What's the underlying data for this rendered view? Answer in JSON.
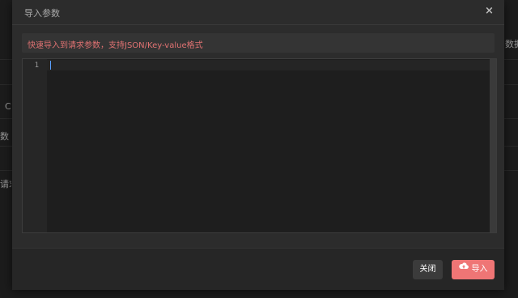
{
  "background": {
    "fragments": [
      "数据",
      "C",
      "数",
      "请求"
    ]
  },
  "modal": {
    "title": "导入参数",
    "close_glyph": "×",
    "tip": "快速导入到请求参数，支持JSON/Key-value格式",
    "editor": {
      "line_numbers": [
        "1"
      ],
      "content": ""
    },
    "buttons": {
      "close_label": "关闭",
      "import_label": "导入",
      "import_icon": "cloud-upload-icon"
    }
  },
  "colors": {
    "tip_text": "#e07272",
    "primary": "#ef7575",
    "cursor": "#5aa0ff"
  }
}
